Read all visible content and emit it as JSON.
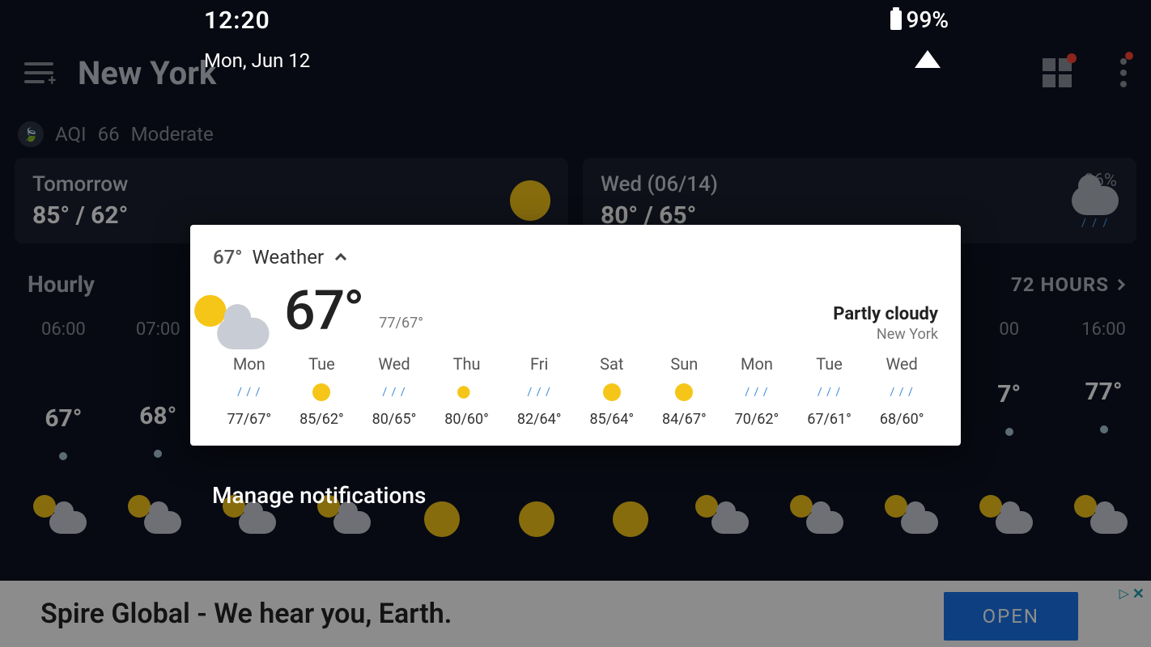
{
  "status": {
    "time": "12:20",
    "date": "Mon, Jun 12",
    "battery": "99%"
  },
  "header": {
    "city": "New York"
  },
  "aqi": {
    "label": "AQI",
    "value": "66",
    "level": "Moderate"
  },
  "cards": {
    "tomorrow": {
      "label": "Tomorrow",
      "temps": "85° / 62°"
    },
    "next": {
      "label": "Wed (06/14)",
      "temps": "80° / 65°",
      "pct": "86%"
    }
  },
  "hourly": {
    "title": "Hourly",
    "link": "72 HOURS",
    "times": [
      "06:00",
      "07:00",
      "",
      "",
      "",
      "",
      "",
      "",
      "",
      "",
      "00",
      "16:00"
    ],
    "temps": [
      "67°",
      "68°",
      "",
      "",
      "",
      "",
      "",
      "",
      "",
      "",
      "7°",
      "77°"
    ]
  },
  "notif": {
    "small_temp": "67°",
    "app_name": "Weather",
    "big_temp": "67°",
    "hl": "77/67°",
    "condition": "Partly cloudy",
    "location": "New York",
    "days": [
      {
        "d": "Mon",
        "i": "rain",
        "hl": "77/67°"
      },
      {
        "d": "Tue",
        "i": "sun",
        "hl": "85/62°"
      },
      {
        "d": "Wed",
        "i": "rain",
        "hl": "80/65°"
      },
      {
        "d": "Thu",
        "i": "psun",
        "hl": "80/60°"
      },
      {
        "d": "Fri",
        "i": "rain",
        "hl": "82/64°"
      },
      {
        "d": "Sat",
        "i": "sun",
        "hl": "85/64°"
      },
      {
        "d": "Sun",
        "i": "sun",
        "hl": "84/67°"
      },
      {
        "d": "Mon",
        "i": "rain",
        "hl": "70/62°"
      },
      {
        "d": "Tue",
        "i": "rain",
        "hl": "67/61°"
      },
      {
        "d": "Wed",
        "i": "rain",
        "hl": "68/60°"
      }
    ]
  },
  "manage": "Manage notifications",
  "ad": {
    "title": "Spire Global - We hear you, Earth.",
    "cta": "OPEN"
  }
}
